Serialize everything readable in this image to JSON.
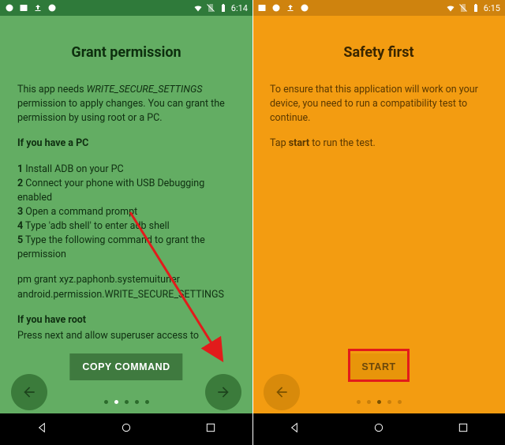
{
  "left": {
    "status": {
      "time": "6:14"
    },
    "title": "Grant permission",
    "intro_pre": "This app needs ",
    "intro_perm": "WRITE_SECURE_SETTINGS",
    "intro_post": " permission to apply changes. You can grant the permission by using root or a PC.",
    "pc_heading": "If you have a PC",
    "step1_n": "1",
    "step1_t": " Install ADB on your PC",
    "step2_n": "2",
    "step2_t": " Connect your phone with USB Debugging enabled",
    "step3_n": "3",
    "step3_t": " Open a command prompt",
    "step4_n": "4",
    "step4_t": " Type 'adb shell' to enter adb shell",
    "step5_n": "5",
    "step5_t": " Type the following command to grant the permission",
    "cmd": "pm grant xyz.paphonb.systemuituner android.permission.WRITE_SECURE_SETTINGS",
    "root_heading": "If you have root",
    "root_text": "Press next and allow superuser access to",
    "copy_label": "COPY COMMAND",
    "pager": {
      "count": 5,
      "active": 1
    }
  },
  "right": {
    "status": {
      "time": "6:15"
    },
    "title": "Safety first",
    "p1": "To ensure that this application will work on your device, you need to run a compatibility test to continue.",
    "p2_pre": "Tap ",
    "p2_bold": "start",
    "p2_post": " to run the test.",
    "start_label": "START",
    "pager": {
      "count": 5,
      "active": 2
    }
  }
}
